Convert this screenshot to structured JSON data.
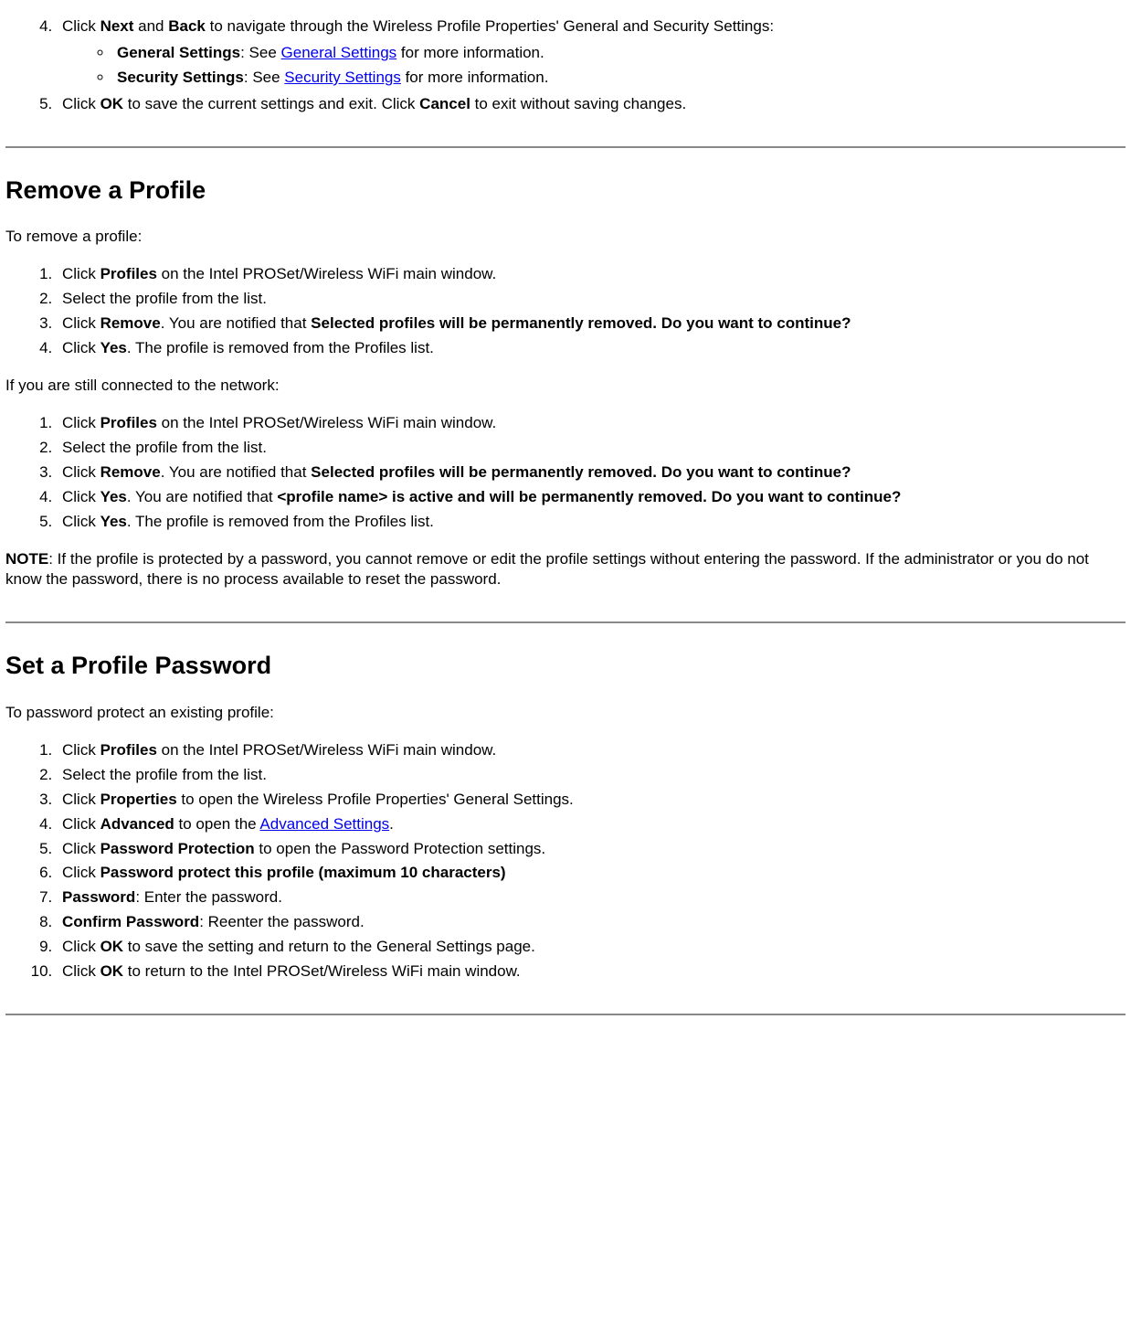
{
  "top": {
    "step4_prefix": "Click ",
    "step4_b1": "Next",
    "step4_mid": " and ",
    "step4_b2": "Back",
    "step4_rest": " to navigate through the Wireless Profile Properties' General and Security Settings:",
    "bullet1_b": "General Settings",
    "bullet1_mid": ": See ",
    "bullet1_link": "General Settings",
    "bullet1_end": " for more information.",
    "bullet2_b": "Security Settings",
    "bullet2_mid": ": See ",
    "bullet2_link": "Security Settings",
    "bullet2_end": " for more information.",
    "step5_prefix": "Click ",
    "step5_b1": "OK",
    "step5_mid": " to save the current settings and exit. Click ",
    "step5_b2": "Cancel",
    "step5_end": " to exit without saving changes."
  },
  "remove": {
    "heading": "Remove a Profile",
    "intro": "To remove a profile:",
    "listA": {
      "s1_pre": "Click ",
      "s1_b": "Profiles",
      "s1_post": " on the Intel PROSet/Wireless WiFi main window.",
      "s2": "Select the profile from the list.",
      "s3_pre": "Click ",
      "s3_b1": "Remove",
      "s3_mid": ". You are notified that ",
      "s3_b2": "Selected profiles will be permanently removed. Do you want to continue?",
      "s4_pre": "Click ",
      "s4_b": "Yes",
      "s4_post": ". The profile is removed from the Profiles list."
    },
    "conn_intro": "If you are still connected to the network:",
    "listB": {
      "s1_pre": "Click ",
      "s1_b": "Profiles",
      "s1_post": " on the Intel PROSet/Wireless WiFi main window.",
      "s2": "Select the profile from the list.",
      "s3_pre": "Click ",
      "s3_b1": "Remove",
      "s3_mid": ". You are notified that ",
      "s3_b2": "Selected profiles will be permanently removed. Do you want to continue?",
      "s4_pre": "Click ",
      "s4_b1": "Yes",
      "s4_mid": ". You are notified that ",
      "s4_b2": "<profile name> is active and will be permanently removed. Do you want to continue?",
      "s5_pre": "Click ",
      "s5_b": "Yes",
      "s5_post": ". The profile is removed from the Profiles list."
    },
    "note_b": "NOTE",
    "note_text": ": If the profile is protected by a password, you cannot remove or edit the profile settings without entering the password. If the administrator or you do not know the password, there is no process available to reset the password."
  },
  "password": {
    "heading": "Set a Profile Password",
    "intro": "To password protect an existing profile:",
    "s1_pre": "Click ",
    "s1_b": "Profiles",
    "s1_post": " on the Intel PROSet/Wireless WiFi main window.",
    "s2": "Select the profile from the list.",
    "s3_pre": "Click ",
    "s3_b": "Properties",
    "s3_post": " to open the Wireless Profile Properties' General Settings.",
    "s4_pre": "Click ",
    "s4_b": "Advanced",
    "s4_mid": " to open the ",
    "s4_link": "Advanced Settings",
    "s4_end": ".",
    "s5_pre": "Click ",
    "s5_b": "Password Protection",
    "s5_post": " to open the Password Protection settings.",
    "s6_pre": "Click ",
    "s6_b": "Password protect this profile (maximum 10 characters)",
    "s7_b": "Password",
    "s7_post": ": Enter the password.",
    "s8_b": "Confirm Password",
    "s8_post": ": Reenter the password.",
    "s9_pre": "Click ",
    "s9_b": "OK",
    "s9_post": " to save the setting and return to the General Settings page.",
    "s10_pre": "Click ",
    "s10_b": "OK",
    "s10_post": " to return to the Intel PROSet/Wireless WiFi main window."
  }
}
